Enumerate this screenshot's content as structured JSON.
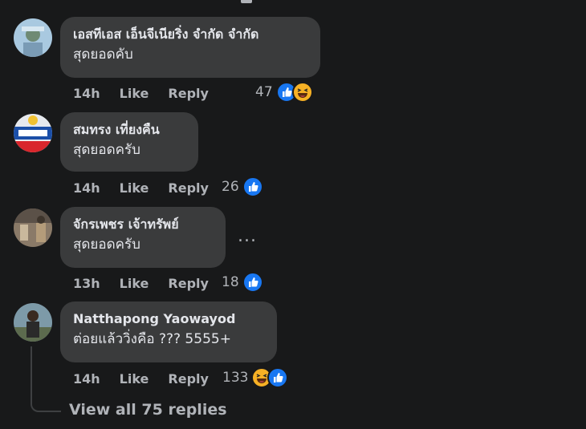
{
  "comments": [
    {
      "author": "เอสทีเอส เอ็นจีเนียริ่ง จำกัด จำกัด",
      "text": "สุดยอดคับ",
      "time": "14h",
      "like_label": "Like",
      "reply_label": "Reply",
      "reaction_count": "47",
      "reactions": [
        "like-icon",
        "haha-icon"
      ]
    },
    {
      "author": "สมทรง เที่ยงคืน",
      "text": "สุดยอดครับ",
      "time": "14h",
      "like_label": "Like",
      "reply_label": "Reply",
      "reaction_count": "26",
      "reactions": [
        "like-icon"
      ]
    },
    {
      "author": "จักรเพชร เจ้าทรัพย์",
      "text": "สุดยอดครับ",
      "time": "13h",
      "like_label": "Like",
      "reply_label": "Reply",
      "reaction_count": "18",
      "reactions": [
        "like-icon"
      ]
    },
    {
      "author": "Natthapong Yaowayod",
      "text": "ต่อยแล้ววิ่งคือ ??? 5555+",
      "time": "14h",
      "like_label": "Like",
      "reply_label": "Reply",
      "reaction_count": "133",
      "reactions": [
        "haha-icon",
        "like-icon"
      ]
    }
  ],
  "more_options": "...",
  "view_replies": "View all 75 replies",
  "colors": {
    "background": "#18191a",
    "bubble": "#3a3b3c",
    "secondary_text": "#b0b3b8",
    "like_blue": "#1877f2",
    "haha_yellow": "#f7b125"
  }
}
